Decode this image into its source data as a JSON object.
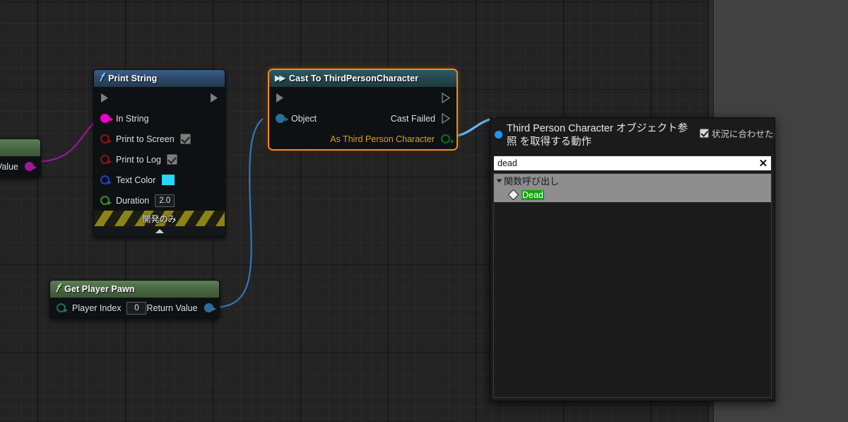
{
  "app": {
    "editor": "Unreal Engine Blueprint Graph Editor"
  },
  "graph": {
    "nodes": [
      {
        "id": "print-string",
        "title": "Print String",
        "title_icon": "function-f-icon",
        "pins": [
          {
            "name": "exec-in",
            "label": "",
            "kind": "exec",
            "side": "in"
          },
          {
            "name": "exec-out",
            "label": "",
            "kind": "exec",
            "side": "out"
          },
          {
            "name": "in-string",
            "label": "In String",
            "kind": "data",
            "side": "in",
            "color": "#f000d0"
          },
          {
            "name": "print-to-screen",
            "label": "Print to Screen",
            "kind": "data",
            "side": "in",
            "color": "#8c1414",
            "widget": "checkbox",
            "checked": true
          },
          {
            "name": "print-to-log",
            "label": "Print to Log",
            "kind": "data",
            "side": "in",
            "color": "#8c1414",
            "widget": "checkbox",
            "checked": true
          },
          {
            "name": "text-color",
            "label": "Text Color",
            "kind": "data",
            "side": "in",
            "color": "#1b44c4",
            "widget": "color",
            "value": "#27d8f7"
          },
          {
            "name": "duration",
            "label": "Duration",
            "kind": "data",
            "side": "in",
            "color": "#3f8c2e",
            "widget": "value",
            "value": "2.0"
          }
        ],
        "footer": "開発のみ"
      },
      {
        "id": "cast-to-third-person-character",
        "title": "Cast To ThirdPersonCharacter",
        "title_icon": "cast-arrows-icon",
        "selected": true,
        "pins": [
          {
            "name": "exec-in",
            "label": "",
            "kind": "exec",
            "side": "in"
          },
          {
            "name": "exec-out",
            "label": "",
            "kind": "exec",
            "side": "out"
          },
          {
            "name": "object",
            "label": "Object",
            "kind": "data",
            "side": "in",
            "color": "#2a6f96"
          },
          {
            "name": "cast-failed",
            "label": "Cast Failed",
            "kind": "exec",
            "side": "out"
          },
          {
            "name": "as-third-person-character",
            "label": "As Third Person Character",
            "kind": "data",
            "side": "out",
            "color": "#0d6b28"
          }
        ]
      },
      {
        "id": "get-player-pawn",
        "title": "Get Player Pawn",
        "title_icon": "function-f-icon",
        "pins": [
          {
            "name": "player-index",
            "label": "Player Index",
            "kind": "data",
            "side": "in",
            "color": "#1f6e5f",
            "widget": "value",
            "value": "0"
          },
          {
            "name": "return-value",
            "label": "Return Value",
            "kind": "data",
            "side": "out",
            "color": "#2a6f96"
          }
        ]
      },
      {
        "id": "offscreen-node",
        "title": "",
        "pins": [
          {
            "name": "value",
            "label": "Value",
            "kind": "data",
            "side": "out",
            "color": "#a0169b"
          }
        ]
      }
    ]
  },
  "context_menu": {
    "title": "Third Person Character オブジェクト参照 を取得する動作",
    "context_toggle": {
      "label": "状況に合わせた表示",
      "checked": true
    },
    "search": {
      "value": "dead",
      "placeholder": "",
      "clear_glyph": "✕"
    },
    "results": [
      {
        "category": "関数呼び出し",
        "expanded": true,
        "items": [
          {
            "label": "Dead",
            "icon": "function-diamond-icon",
            "highlighted": true
          }
        ]
      }
    ]
  },
  "colors": {
    "canvas_bg": "#232323",
    "selection": "#f28c1e",
    "exec_wire": "#b8b8b8",
    "object_wire": "#2f7bbd",
    "drag_wire": "#64b4f0",
    "string_wire": "#a0169b",
    "menu_bg": "#1b1b1b",
    "highlight_green": "#14a014",
    "right_panel": "#424242"
  }
}
